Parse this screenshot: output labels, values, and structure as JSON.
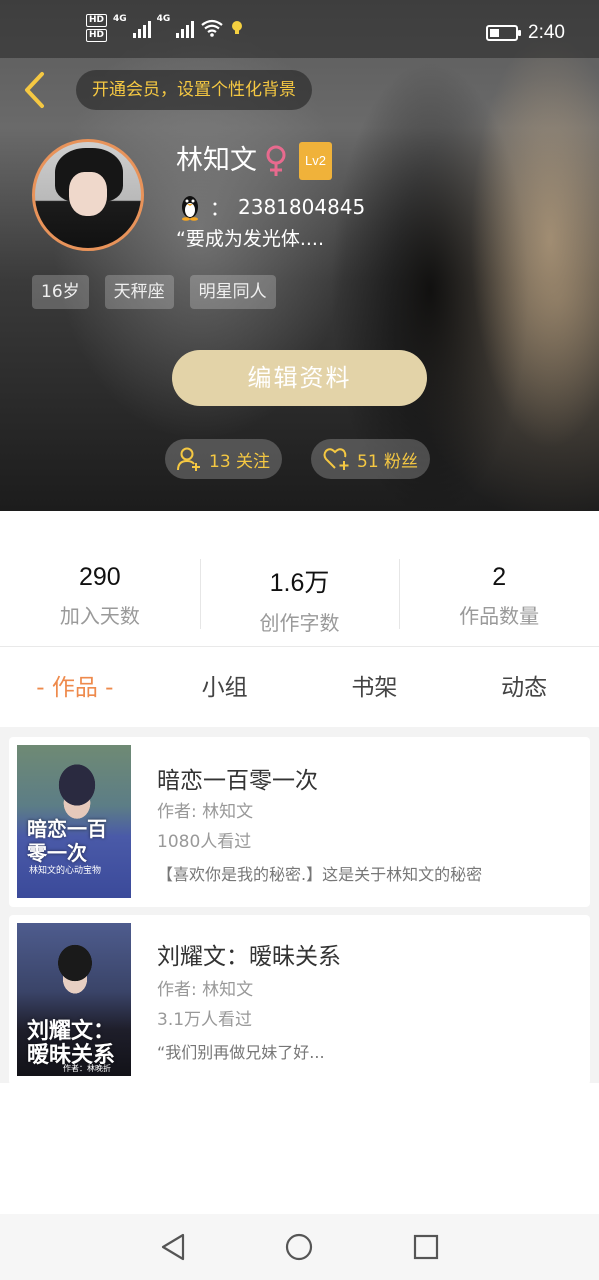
{
  "status_bar": {
    "hd1": "HD",
    "hd2": "HD",
    "net1": "4G",
    "net2": "4G",
    "time": "2:40"
  },
  "header": {
    "vip_text": "开通会员，设置个性化背景"
  },
  "profile": {
    "name": "林知文",
    "level": "Lv2",
    "qq_separator": "：",
    "qq_number": "2381804845",
    "bio": "“要成为发光体....",
    "tags": [
      "16岁",
      "天秤座",
      "明星同人"
    ],
    "edit_label": "编辑资料",
    "following_label": "13 关注",
    "fans_label": "51 粉丝"
  },
  "stats": [
    {
      "value": "290",
      "label": "加入天数"
    },
    {
      "value": "1.6万",
      "label": "创作字数"
    },
    {
      "value": "2",
      "label": "作品数量"
    }
  ],
  "tabs": [
    {
      "label": "- 作品 -",
      "active": true
    },
    {
      "label": "小组",
      "active": false
    },
    {
      "label": "书架",
      "active": false
    },
    {
      "label": "动态",
      "active": false
    }
  ],
  "works": [
    {
      "title": "暗恋一百零一次",
      "author": "作者: 林知文",
      "views": "1080人看过",
      "desc": "【喜欢你是我的秘密.】这是关于林知文的秘密",
      "cover_title": "暗恋一百零一次",
      "cover_sub": "林知文的心动宝物"
    },
    {
      "title": "刘耀文：暧昧关系",
      "author": "作者: 林知文",
      "views": "3.1万人看过",
      "desc": "“我们别再做兄妹了好...",
      "cover_title": "刘耀文：暧昧关系",
      "cover_sub": "作者：林晚折"
    }
  ],
  "colors": {
    "accent_orange": "#ee8a4c",
    "gold_text": "#f5c842",
    "level_badge": "#f0b23a",
    "edit_button": "#e3d3a8",
    "avatar_border": "#e8935a",
    "female_icon": "#e86a8e"
  }
}
